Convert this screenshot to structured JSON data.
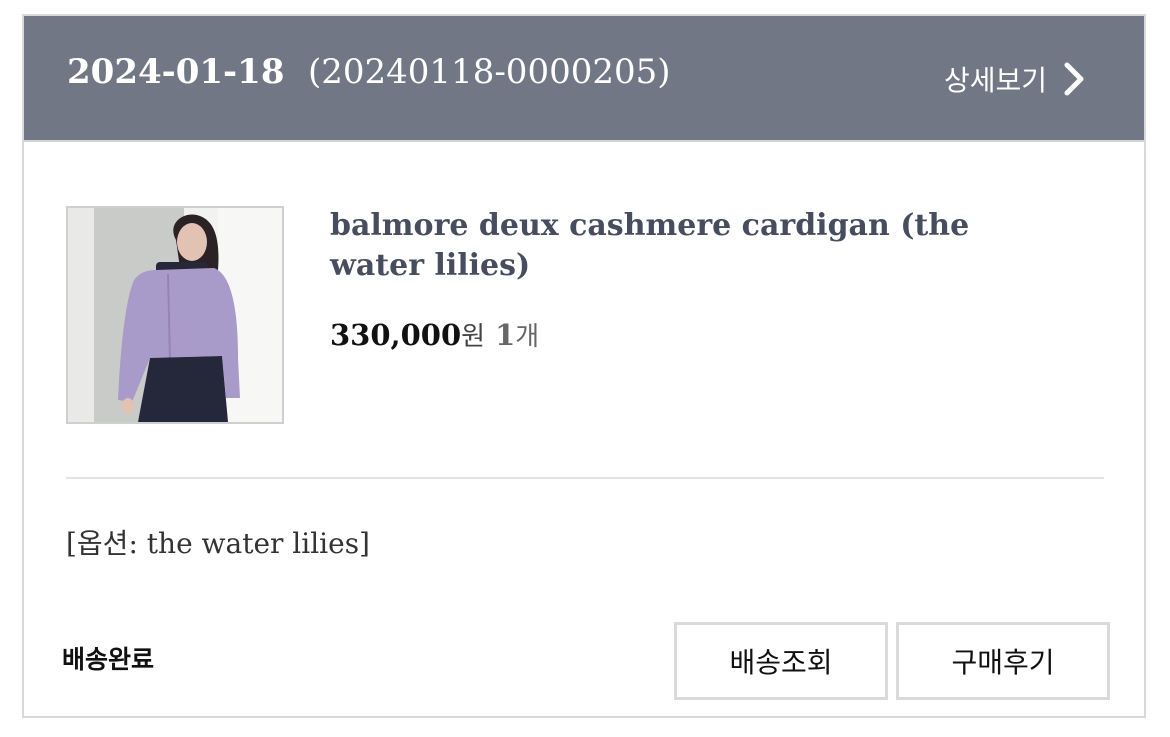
{
  "order": {
    "date": "2024-01-18",
    "number": "(20240118-0000205)",
    "detail_label": "상세보기",
    "detail_icon": "chevron-right-icon"
  },
  "product": {
    "name": "balmore deux cashmere cardigan (the water lilies)",
    "price": "330,000",
    "price_unit": "원",
    "quantity": "1",
    "quantity_unit": "개",
    "option": "[옵션: the water lilies]"
  },
  "status": {
    "label": "배송완료"
  },
  "actions": {
    "track_label": "배송조회",
    "review_label": "구매후기"
  },
  "colors": {
    "header_bg": "#717785",
    "product_name": "#474d5e",
    "cardigan": "#a99bc9"
  }
}
